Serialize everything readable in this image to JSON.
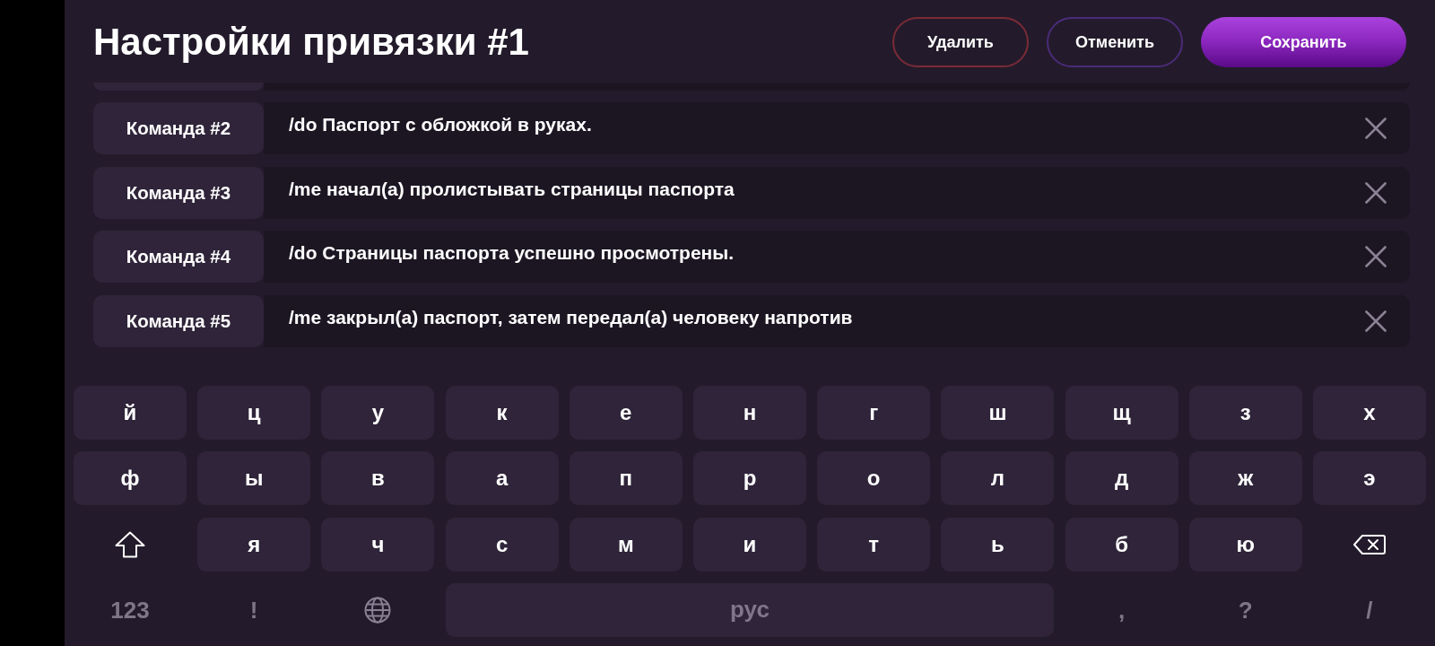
{
  "header": {
    "title": "Настройки привязки #1",
    "buttons": [
      {
        "label": "Удалить",
        "kind": "danger"
      },
      {
        "label": "Отменить",
        "kind": "secondary"
      },
      {
        "label": "Сохранить",
        "kind": "primary"
      }
    ]
  },
  "commands": [
    {
      "label": "Команда #2",
      "text": "/do Паспорт с обложкой в руках."
    },
    {
      "label": "Команда #3",
      "text": "/me начал(а) пролистывать страницы паспорта"
    },
    {
      "label": "Команда #4",
      "text": "/do Страницы паспорта успешно просмотрены."
    },
    {
      "label": "Команда #5",
      "text": "/me закрыл(а) паспорт, затем передал(а) человеку напротив"
    }
  ],
  "keyboard": {
    "letter_rows": [
      [
        {
          "kind": "char",
          "label": "й"
        },
        {
          "kind": "char",
          "label": "ц"
        },
        {
          "kind": "char",
          "label": "у"
        },
        {
          "kind": "char",
          "label": "к"
        },
        {
          "kind": "char",
          "label": "е"
        },
        {
          "kind": "char",
          "label": "н"
        },
        {
          "kind": "char",
          "label": "г"
        },
        {
          "kind": "char",
          "label": "ш"
        },
        {
          "kind": "char",
          "label": "щ"
        },
        {
          "kind": "char",
          "label": "з"
        },
        {
          "kind": "char",
          "label": "х"
        }
      ],
      [
        {
          "kind": "char",
          "label": "ф"
        },
        {
          "kind": "char",
          "label": "ы"
        },
        {
          "kind": "char",
          "label": "в"
        },
        {
          "kind": "char",
          "label": "а"
        },
        {
          "kind": "char",
          "label": "п"
        },
        {
          "kind": "char",
          "label": "р"
        },
        {
          "kind": "char",
          "label": "о"
        },
        {
          "kind": "char",
          "label": "л"
        },
        {
          "kind": "char",
          "label": "д"
        },
        {
          "kind": "char",
          "label": "ж"
        },
        {
          "kind": "char",
          "label": "э"
        }
      ],
      [
        {
          "kind": "shift"
        },
        {
          "kind": "char",
          "label": "я"
        },
        {
          "kind": "char",
          "label": "ч"
        },
        {
          "kind": "char",
          "label": "с"
        },
        {
          "kind": "char",
          "label": "м"
        },
        {
          "kind": "char",
          "label": "и"
        },
        {
          "kind": "char",
          "label": "т"
        },
        {
          "kind": "char",
          "label": "ь"
        },
        {
          "kind": "char",
          "label": "б"
        },
        {
          "kind": "char",
          "label": "ю"
        },
        {
          "kind": "backspace"
        }
      ]
    ],
    "bottom_row": [
      {
        "kind": "fn",
        "label": "123"
      },
      {
        "kind": "fn",
        "label": "!"
      },
      {
        "kind": "globe"
      },
      {
        "kind": "space",
        "label": "рус"
      },
      {
        "kind": "fn",
        "label": ","
      },
      {
        "kind": "fn",
        "label": "?"
      },
      {
        "kind": "fn",
        "label": "/"
      }
    ]
  }
}
